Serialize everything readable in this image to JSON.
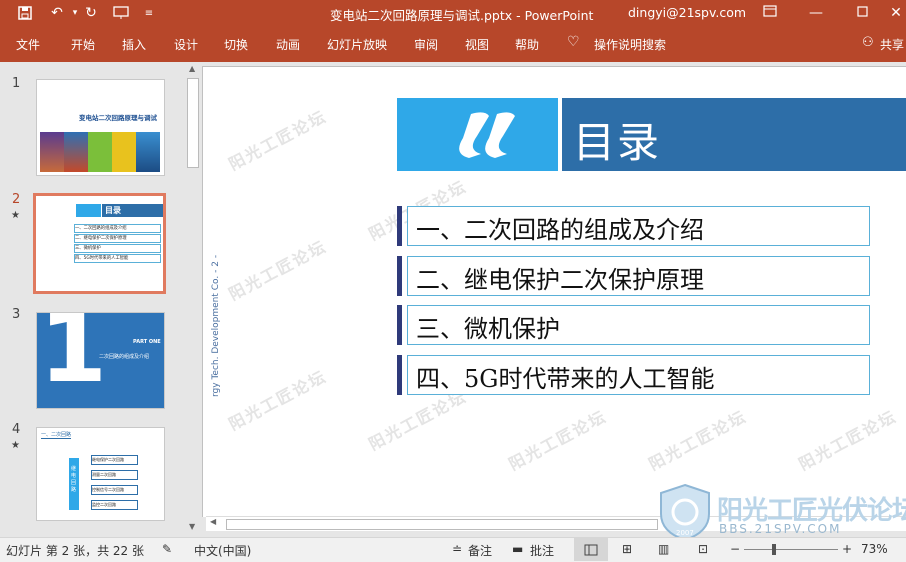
{
  "app": {
    "doc_title": "变电站二次回路原理与调试.pptx  -  PowerPoint",
    "user_email": "dingyi@21spv.com"
  },
  "ribbon": {
    "tabs": [
      "文件",
      "开始",
      "插入",
      "设计",
      "切换",
      "动画",
      "幻灯片放映",
      "审阅",
      "视图",
      "帮助"
    ],
    "tell_me": "操作说明搜索",
    "share": "共享"
  },
  "thumbnails": {
    "numbers": [
      "1",
      "2",
      "3",
      "4"
    ],
    "star": "★",
    "slide1_title": "变电站二次回路原理与调试",
    "slide2_title": "目录",
    "slide2_items": [
      "一、二次回路的组成及介绍",
      "二、继电保护二次保护原理",
      "三、微机保护",
      "四、5G时代带来的人工智能"
    ],
    "slide3_number": "1",
    "slide3_part": "PART ONE",
    "slide3_sub": "二次回路的组成及介绍",
    "slide4_header": "一、二次回路",
    "slide4_center": "继电回路",
    "slide4_items": [
      "继电保护二次回路",
      "测量二次回路",
      "控制信号二次回路",
      "监控二次回路"
    ]
  },
  "slide": {
    "title": "目录",
    "toc_items": [
      "一、二次回路的组成及介绍",
      "二、继电保护二次保护原理",
      "三、微机保护",
      "四、5G时代带来的人工智能"
    ],
    "vertical_text": "rgy Tech. Development Co. - 2 -",
    "watermark": "阳光工匠论坛"
  },
  "logo": {
    "name": "阳光工匠光伏论坛",
    "url": "BBS.21SPV.COM",
    "year": "2007"
  },
  "status": {
    "slide_info": "幻灯片 第 2 张，共 22 张",
    "language": "中文(中国)",
    "notes": "备注",
    "comments": "批注",
    "zoom": "73%"
  },
  "colors": {
    "accent": "#b7472a",
    "banner_light": "#2fa8e8",
    "banner_dark": "#2d6ea8",
    "toc_border": "#5ab0d8",
    "toc_bar": "#2f3a7a",
    "selected_thumb": "#e07a5f"
  }
}
